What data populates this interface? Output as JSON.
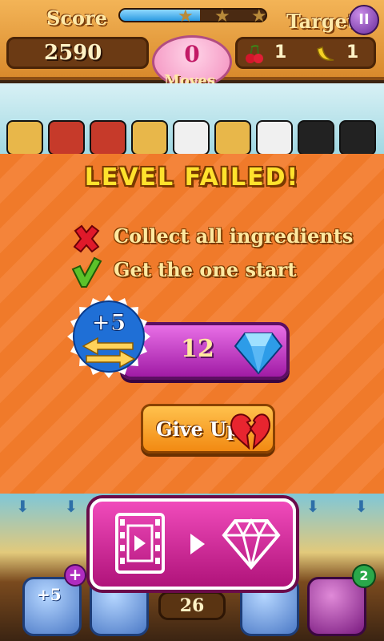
{
  "hud": {
    "score_label": "Score",
    "score_value": "2590",
    "target_label": "Target",
    "moves_value": "0",
    "moves_label": "Moves",
    "target_items": [
      {
        "icon": "cherry-icon",
        "count": "1"
      },
      {
        "icon": "banana-icon",
        "count": "1"
      }
    ],
    "progress_fraction": 0.55,
    "stars_count": 3
  },
  "dialog": {
    "title": "LEVEL FAILED!",
    "goals": [
      {
        "status": "failed",
        "icon": "red-x-icon",
        "text": "Collect all ingredients"
      },
      {
        "status": "done",
        "icon": "green-check-icon",
        "text": "Get the one start"
      }
    ],
    "offer": {
      "badge_text": "+5",
      "badge_icon": "moves-arrows-icon",
      "price": "12",
      "currency_icon": "blue-diamond-icon"
    },
    "give_up_label": "Give Up",
    "give_up_icon": "broken-heart-icon"
  },
  "bottom": {
    "moves_count": "26",
    "booster_plus5": "+5",
    "booster_badge_count": "2",
    "video_offer_icons": [
      "film-icon",
      "play-arrow-icon",
      "diamond-icon"
    ]
  },
  "colors": {
    "panel_orange": "#f07a2a",
    "title_yellow": "#ffe22d",
    "buy_purple": "#b21db8",
    "giveup_orange": "#f5a024",
    "video_pink": "#e0279e"
  }
}
